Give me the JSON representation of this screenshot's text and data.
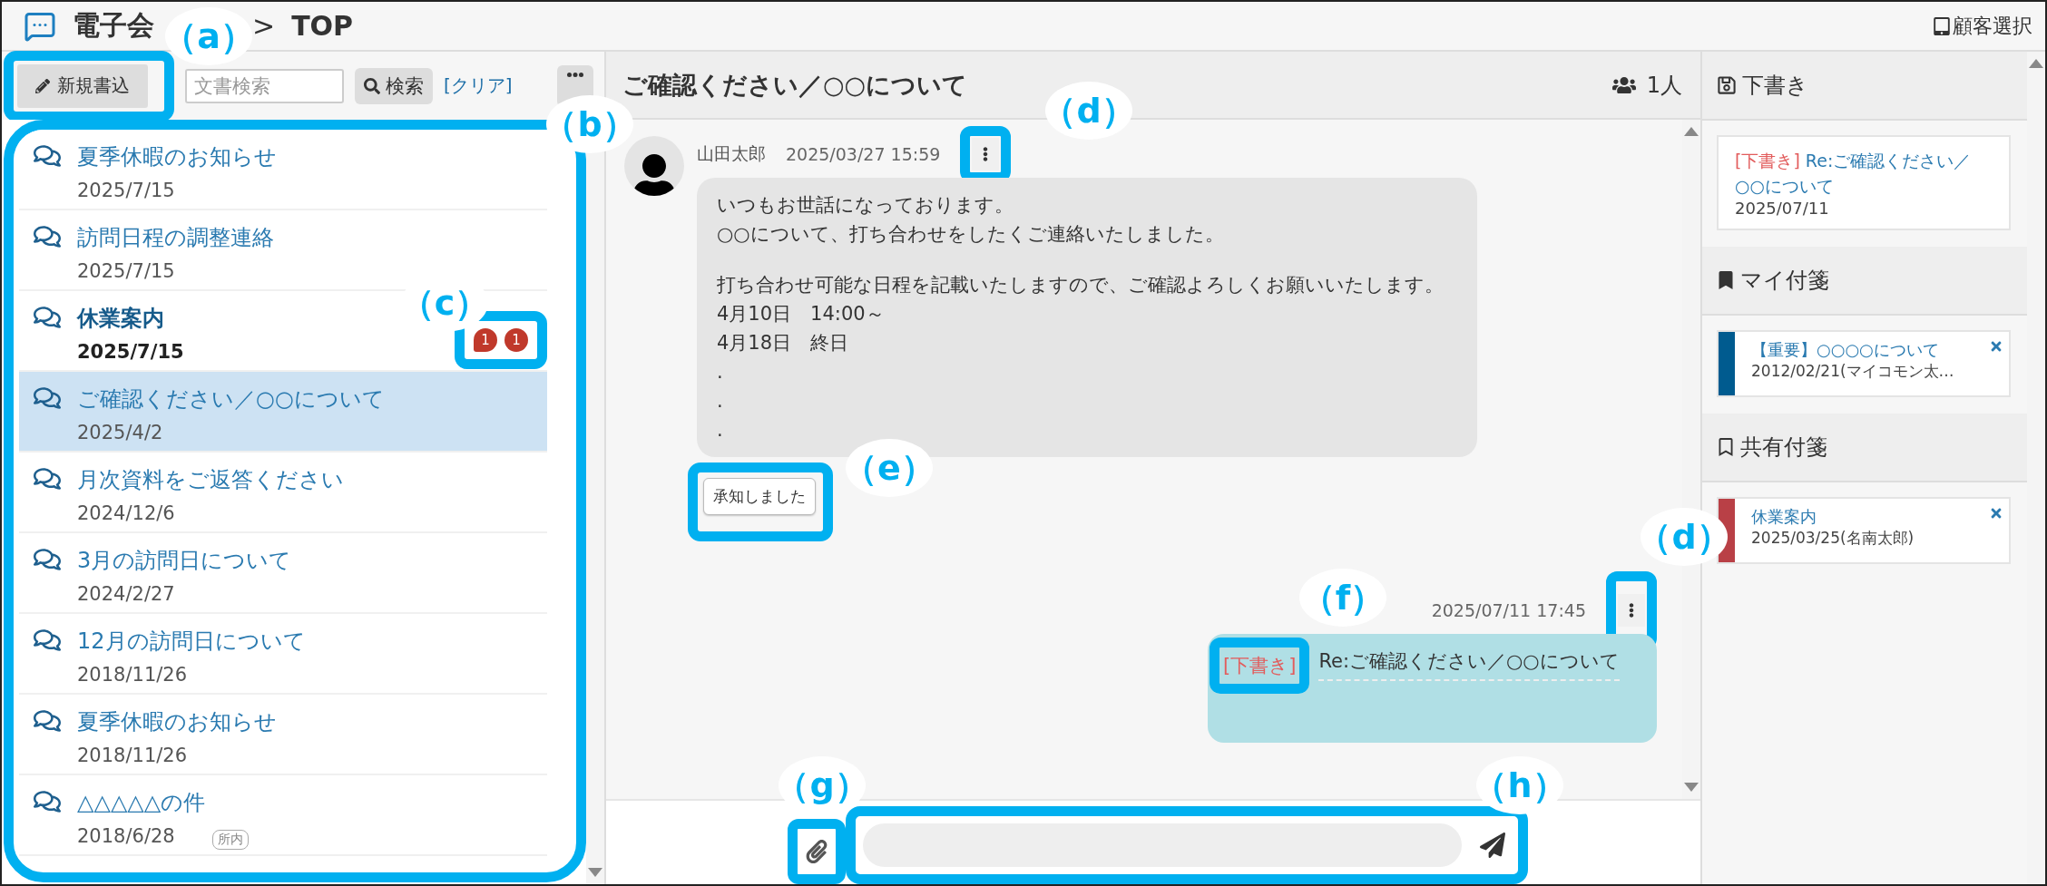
{
  "header": {
    "app_title": "電子会",
    "separator": ">",
    "page": "TOP",
    "customer_select": "顧客選択"
  },
  "toolbar": {
    "new_button": "新規書込",
    "search": {
      "placeholder": "文書検索"
    },
    "search_button": "検索",
    "clear_link": "[クリア]"
  },
  "threads": [
    {
      "title": "夏季休暇のお知らせ",
      "date": "2025/7/15",
      "unread": false,
      "selected": false
    },
    {
      "title": "訪問日程の調整連絡",
      "date": "2025/7/15",
      "unread": false,
      "selected": false
    },
    {
      "title": "休業案内",
      "date": "2025/7/15",
      "unread": true,
      "selected": false,
      "badges": [
        {
          "kind": "comment",
          "count": "1"
        },
        {
          "kind": "count",
          "count": "1"
        }
      ]
    },
    {
      "title": "ご確認ください／○○について",
      "date": "2025/4/2",
      "unread": false,
      "selected": true
    },
    {
      "title": "月次資料をご返答ください",
      "date": "2024/12/6",
      "unread": false,
      "selected": false
    },
    {
      "title": "3月の訪問日について",
      "date": "2024/2/27",
      "unread": false,
      "selected": false
    },
    {
      "title": "12月の訪問日について",
      "date": "2018/11/26",
      "unread": false,
      "selected": false
    },
    {
      "title": "夏季休暇のお知らせ",
      "date": "2018/11/26",
      "unread": false,
      "selected": false
    },
    {
      "title": "△△△△△の件",
      "date": "2018/6/28",
      "unread": false,
      "selected": false,
      "tag": "所内"
    }
  ],
  "conversation": {
    "title": "ご確認ください／○○について",
    "members": "1人",
    "messages": [
      {
        "kind": "received",
        "author": "山田太郎",
        "time": "2025/03/27 15:59",
        "paragraphs": [
          [
            "いつもお世話になっております。",
            "○○について、打ち合わせをしたくご連絡いたしました。"
          ],
          [
            "打ち合わせ可能な日程を記載いたしますので、ご確認よろしくお願いいたします。",
            "4月10日　14:00～",
            "4月18日　終日",
            ".",
            ".",
            "."
          ]
        ],
        "reaction": "承知しました"
      },
      {
        "kind": "sent",
        "time": "2025/07/11 17:45",
        "draft_tag": "[下書き]",
        "text": "Re:ご確認ください／○○について"
      }
    ]
  },
  "side": {
    "drafts": {
      "heading": "下書き",
      "items": [
        {
          "tag": "[下書き]",
          "title": "Re:ご確認ください／○○について",
          "date": "2025/07/11"
        }
      ]
    },
    "my_notes": {
      "heading": "マイ付箋",
      "items": [
        {
          "title": "【重要】○○○○について",
          "meta": "2012/02/21(マイコモン太…",
          "color": "#005b8f"
        }
      ]
    },
    "shared_notes": {
      "heading": "共有付箋",
      "items": [
        {
          "title": "休業案内",
          "meta": "2025/03/25(名南太郎)",
          "color": "#b94046"
        }
      ]
    }
  },
  "annotations": [
    {
      "label": "（a）"
    },
    {
      "label": "（b）"
    },
    {
      "label": "（c）"
    },
    {
      "label": "（d）"
    },
    {
      "label": "（e）"
    },
    {
      "label": "（d）"
    },
    {
      "label": "（f）"
    },
    {
      "label": "（g）"
    },
    {
      "label": "（h）"
    }
  ]
}
